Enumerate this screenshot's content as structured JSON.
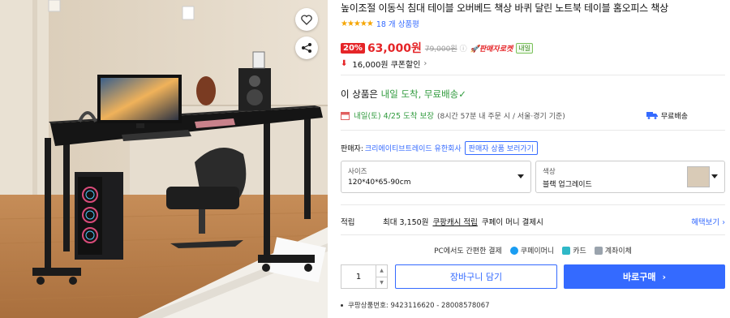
{
  "product": {
    "title": "높이조절 이동식 침대 테이블 오버베드 책상 바퀴 달린 노트북 테이블 홈오피스 책상",
    "rating_stars": "★★★★★",
    "review_count": "18 개 상품평"
  },
  "price": {
    "discount": "20%",
    "sale": "63,000원",
    "original": "79,000원",
    "info_icon": "ⓘ",
    "rocket_label": "판매자로켓",
    "tomorrow_badge": "내일",
    "coupon_amount": "16,000원",
    "coupon_label": "쿠폰할인",
    "coupon_chevron": "›"
  },
  "delivery": {
    "title_prefix": "이 상품은 ",
    "title_highlight": "내일 도착, 무료배송",
    "check": "✓",
    "date_green": "내일(토) 4/25 도착 보장",
    "date_note": "(8시간 57분 내 주문 시 / 서울·경기 기준)",
    "free_shipping": "무료배송"
  },
  "seller": {
    "label": "판매자:",
    "name": "크리에이티브트레이드 유한회사",
    "more_button": "판매자 상품 보러가기"
  },
  "options": {
    "size_label": "사이즈",
    "size_value": "120*40*65-90cm",
    "color_label": "색상",
    "color_value": "블랙 업그레이드"
  },
  "points": {
    "label": "적립",
    "max": "최대 3,150원",
    "cash": "쿠팡캐시 적립",
    "payment": "쿠페이 머니 결제시",
    "benefit_link": "혜택보기",
    "benefit_chevron": "›"
  },
  "pay": {
    "text": "PC에서도 간편한 결제",
    "method1": "쿠페이머니",
    "method2": "카드",
    "method3": "계좌이체",
    "colors": {
      "coupay": "#1a9df2",
      "card": "#2fb8c7",
      "bank": "#9aa3ad"
    }
  },
  "actions": {
    "qty": "1",
    "up": "▲",
    "down": "▼",
    "cart": "장바구니 담기",
    "buy": "바로구매",
    "buy_chevron": "›"
  },
  "meta": {
    "product_number": "쿠팡상품번호: 9423116620 - 28008578067"
  },
  "colors": {
    "accent": "#346aff",
    "sale": "#e52528",
    "green": "#2f9a3c"
  }
}
